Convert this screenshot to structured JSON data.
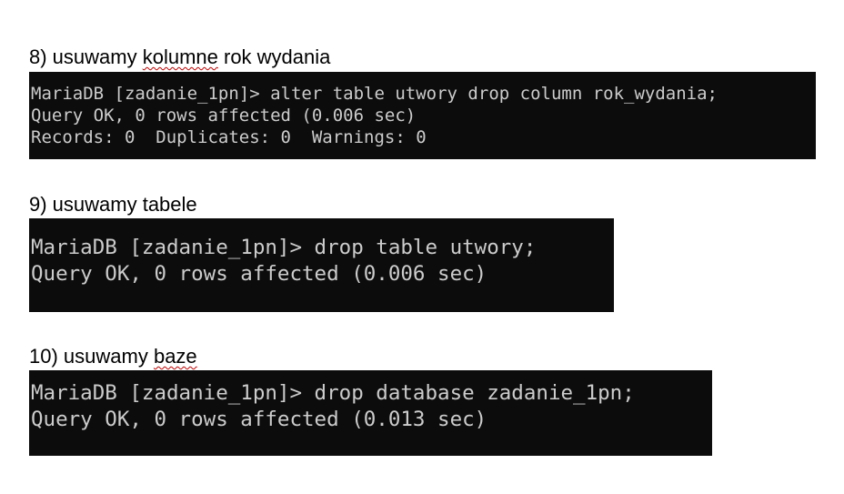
{
  "sections": [
    {
      "heading_prefix": "8) usuwamy ",
      "heading_flagged": "kolumne",
      "heading_suffix": " rok wydania",
      "terminal_lines": [
        "MariaDB [zadanie_1pn]> alter table utwory drop column rok_wydania;",
        "Query OK, 0 rows affected (0.006 sec)",
        "Records: 0  Duplicates: 0  Warnings: 0"
      ]
    },
    {
      "heading_prefix": "9) usuwamy tabele",
      "heading_flagged": "",
      "heading_suffix": "",
      "terminal_lines": [
        "MariaDB [zadanie_1pn]> drop table utwory;",
        "Query OK, 0 rows affected (0.006 sec)"
      ]
    },
    {
      "heading_prefix": "10) usuwamy ",
      "heading_flagged": "baze",
      "heading_suffix": "",
      "terminal_lines": [
        "MariaDB [zadanie_1pn]> drop database zadanie_1pn;",
        "Query OK, 0 rows affected (0.013 sec)"
      ]
    }
  ],
  "colors": {
    "terminal_bg": "#0c0c0c",
    "terminal_fg": "#cccccc",
    "spellcheck_underline": "#c00000"
  }
}
